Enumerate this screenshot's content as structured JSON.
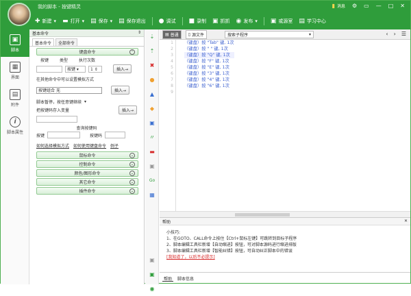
{
  "titlebar": {
    "title": "我的脚本 - 按键精灵",
    "message_label": "消息",
    "window_controls": [
      "⚙",
      "▭",
      "—",
      "□",
      "✕"
    ]
  },
  "toolbar": [
    {
      "icon": "plus-icon",
      "glyph": "✚",
      "label": "新建"
    },
    {
      "icon": "folder-icon",
      "glyph": "▬",
      "label": "打开"
    },
    {
      "icon": "save-icon",
      "glyph": "▤",
      "label": "保存"
    },
    {
      "icon": "save-as-icon",
      "glyph": "▤",
      "label": "保存退出"
    },
    {
      "icon": "debug-icon",
      "glyph": "●",
      "label": "调试"
    },
    {
      "icon": "record-icon",
      "glyph": "■",
      "label": "录制"
    },
    {
      "icon": "grab-icon",
      "glyph": "▣",
      "label": "抓抓"
    },
    {
      "icon": "publish-icon",
      "glyph": "◉",
      "label": "发布"
    },
    {
      "icon": "dashboard-icon",
      "glyph": "▣",
      "label": "或源室"
    },
    {
      "icon": "learn-icon",
      "glyph": "▤",
      "label": "学习中心"
    }
  ],
  "leftnav": [
    {
      "label": "脚本",
      "glyph": "▣",
      "active": true
    },
    {
      "label": "界面",
      "glyph": "▦",
      "active": false
    },
    {
      "label": "附件",
      "glyph": "▤",
      "active": false
    },
    {
      "label": "脚本属性",
      "glyph": "i",
      "active": false
    }
  ],
  "cmdpanel": {
    "header": "基本命令",
    "pin": "⇕",
    "tabs": [
      "基本命令",
      "全部命令"
    ],
    "keyboard_section": "键盘命令",
    "col_key": "按键",
    "col_type": "类型",
    "col_count": "执行次数",
    "type_value": "按键",
    "count_value": "1",
    "insert_label": "插入→",
    "hint_other_window": "在其他命令中可以设置模拟方式",
    "combo_label": "按键组合",
    "combo_value": "无",
    "pause_label": "脚本暂停，按任意键继续",
    "save_key_label": "把按键码存入变量",
    "query_title": "查询按键码",
    "query_key": "按键",
    "query_code": "按键码",
    "links": [
      "如何选择模拟方式",
      "如何使用键盘命令",
      "例子"
    ],
    "sections": [
      "鼠标命令",
      "控制命令",
      "颜色/图形命令",
      "其它命令",
      "插件命令"
    ]
  },
  "iconstrip": [
    "⇣",
    "⇡",
    "✖",
    "●",
    "▲",
    "◆",
    "▣",
    "〃",
    "▬",
    "▣",
    "Go",
    "▦",
    "▣",
    "▣",
    "◉"
  ],
  "editor": {
    "tab_source": "普通",
    "tab_file": "源文件",
    "select_placeholder": "搜索子程序",
    "nav_prev": "‹",
    "nav_next": "›",
    "nav_menu": "☰",
    "lines": [
      "（键盘）按 \"Tab\" 键, 1次",
      "（键盘）按 \" \" 键, 1次",
      "（键盘）按 \"Q\" 键, 1次",
      "（键盘）按 \"F\" 键, 1次",
      "（键盘）按 \"E\" 键, 1次",
      "（键盘）按 \"3\" 键, 1次",
      "（键盘）按 \"4\" 键, 1次",
      "（键盘）按 \"6\" 键, 1次"
    ],
    "line_numbers": [
      "1",
      "2",
      "3",
      "4",
      "5",
      "6",
      "7",
      "8",
      "9"
    ]
  },
  "help": {
    "title": "帮助",
    "close": "✕",
    "tip_title": "小技巧:",
    "tips": [
      "1、在GOTO、CALL命令上按住【Ctrl+鼠标左键】可跳转到目标子程序",
      "2、脚本编辑工具栏新增【自动缩进】按钮，可对脚本源码进行缩进排版",
      "3、脚本编辑工具栏新增【智能纠错】按钮，可自动纠正脚本中的错误"
    ],
    "dismiss": "[我知道了，以后不必提示]"
  },
  "bottomtabs": [
    "帮助",
    "脚本信息"
  ]
}
